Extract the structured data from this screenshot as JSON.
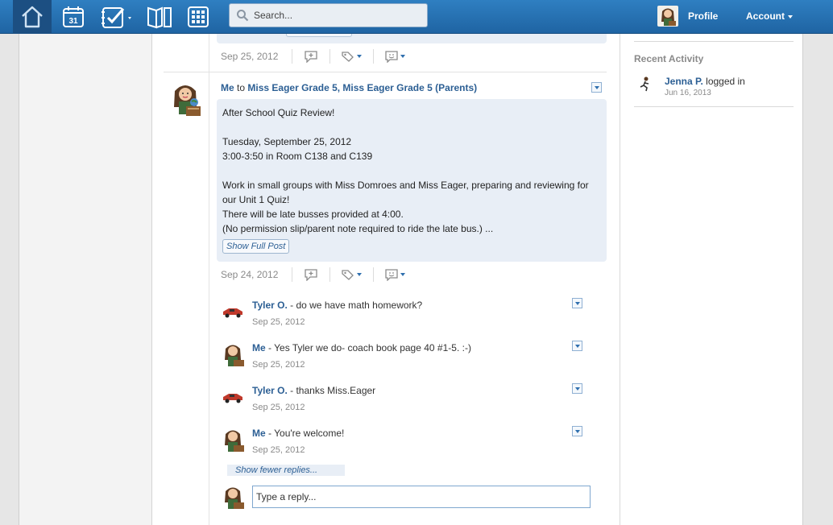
{
  "topbar": {
    "search_placeholder": "Search...",
    "calendar_day": "31",
    "profile_label": "Profile",
    "account_label": "Account",
    "accent_color": "#2a74b6"
  },
  "feed": {
    "previous_post_date": "Sep 25, 2012",
    "post": {
      "author": "Me",
      "to_word": "to",
      "recipients": "Miss Eager Grade 5, Miss Eager Grade 5 (Parents)",
      "lines": [
        "After School Quiz Review!",
        "",
        "Tuesday, September 25, 2012",
        "3:00-3:50 in Room C138 and C139",
        "",
        "Work in small groups with Miss Domroes and Miss Eager, preparing and reviewing for",
        "our Unit 1 Quiz!",
        "There will be late busses provided at 4:00.",
        "(No permission slip/parent note required to ride the late bus.) ..."
      ],
      "show_full_label": "Show Full Post",
      "date": "Sep 24, 2012"
    },
    "replies": [
      {
        "author": "Tyler O.",
        "text": " - do we have math homework?",
        "date": "Sep 25, 2012",
        "avatar": "race-car-avatar"
      },
      {
        "author": "Me",
        "text": " - Yes Tyler we do- coach book page 40 #1-5. :-)",
        "date": "Sep 25, 2012",
        "avatar": "teacher-avatar"
      },
      {
        "author": "Tyler O.",
        "text": " - thanks Miss.Eager",
        "date": "Sep 25, 2012",
        "avatar": "race-car-avatar"
      },
      {
        "author": "Me",
        "text": " - You're welcome!",
        "date": "Sep 25, 2012",
        "avatar": "teacher-avatar"
      }
    ],
    "show_fewer_label": "Show fewer replies...",
    "reply_placeholder": "Type a reply..."
  },
  "sidebar": {
    "title": "Recent Activity",
    "activity": {
      "name": "Jenna P.",
      "action": " logged in",
      "date": "Jun 16, 2013"
    }
  }
}
